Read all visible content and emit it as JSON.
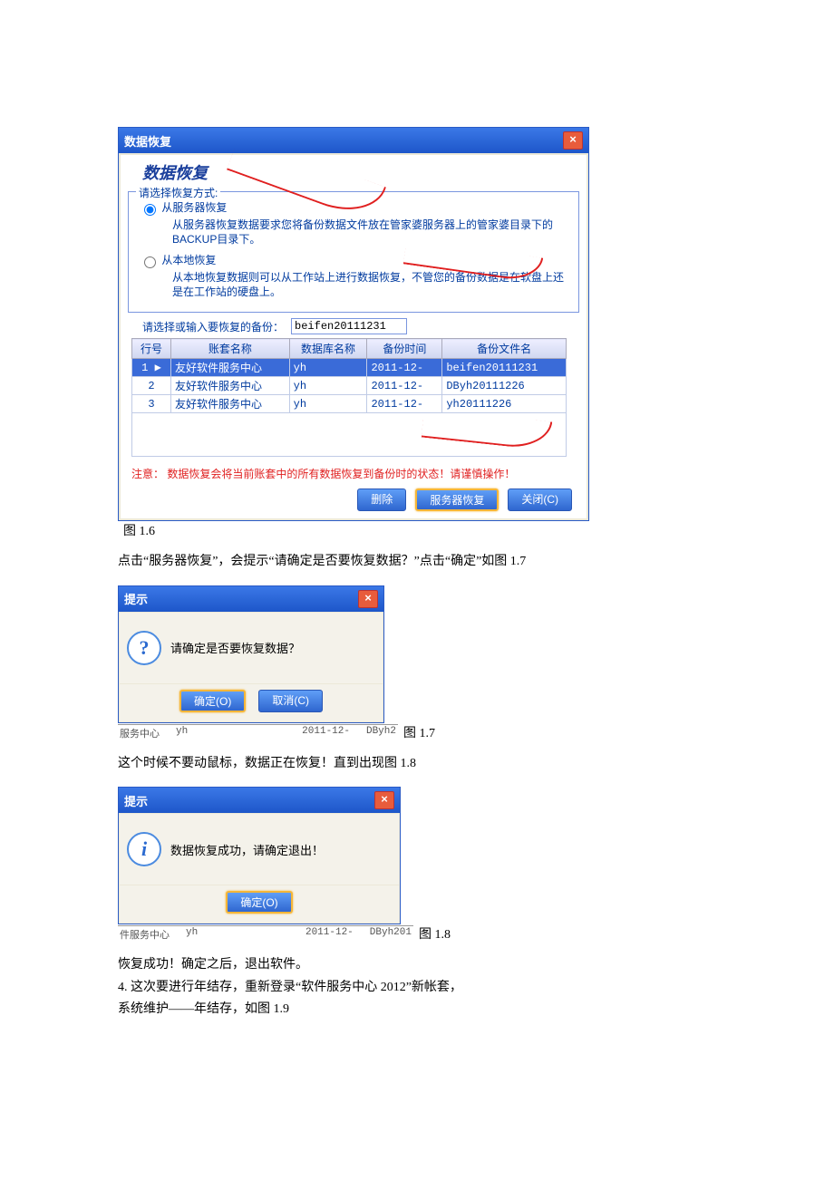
{
  "fig16": {
    "title_bar": "数据恢复",
    "heading": "数据恢复",
    "group_legend": "请选择恢复方式:",
    "radio_server": "从服务器恢复",
    "radio_server_desc": "从服务器恢复数据要求您将备份数据文件放在管家婆服务器上的管家婆目录下的BACKUP目录下。",
    "radio_local": "从本地恢复",
    "radio_local_desc": "从本地恢复数据则可以从工作站上进行数据恢复，不管您的备份数据是在软盘上还是在工作站的硬盘上。",
    "select_label": "请选择或输入要恢复的备份：",
    "select_value": "beifen20111231",
    "columns": {
      "c1": "行号",
      "c2": "账套名称",
      "c3": "数据库名称",
      "c4": "备份时间",
      "c5": "备份文件名"
    },
    "rows": [
      {
        "n": "1",
        "acct": "友好软件服务中心",
        "db": "yh",
        "time": "2011-12-",
        "file": "beifen20111231"
      },
      {
        "n": "2",
        "acct": "友好软件服务中心",
        "db": "yh",
        "time": "2011-12-",
        "file": "DByh20111226"
      },
      {
        "n": "3",
        "acct": "友好软件服务中心",
        "db": "yh",
        "time": "2011-12-",
        "file": "yh20111226"
      }
    ],
    "warning": "注意： 数据恢复会将当前账套中的所有数据恢复到备份时的状态！请谨慎操作！",
    "btn_delete": "删除",
    "btn_restore": "服务器恢复",
    "btn_close": "关闭(C)",
    "caption": "图 1.6"
  },
  "para1": "点击“服务器恢复”，会提示“请确定是否要恢复数据？”点击“确定”如图 1.7",
  "prompt1": {
    "title": "提示",
    "msg": "请确定是否要恢复数据？",
    "ok": "确定(O)",
    "cancel": "取消(C)",
    "ghost1": "服务中心",
    "ghost2": "yh",
    "ghost3": "2011-12-",
    "ghost4": "DByh2",
    "caption": "图 1.7"
  },
  "para2": "这个时候不要动鼠标，数据正在恢复！直到出现图 1.8",
  "prompt2": {
    "title": "提示",
    "msg": "数据恢复成功，请确定退出！",
    "ok": "确定(O)",
    "ghost1": "件服务中心",
    "ghost2": "yh",
    "ghost3": "2011-12-",
    "ghost4": "DByh201",
    "caption": "图 1.8"
  },
  "para3a": "恢复成功！确定之后，退出软件。",
  "para3b": "4.  这次要进行年结存，重新登录“软件服务中心 2012”新帐套，",
  "para3c": "系统维护——年结存，如图 1.9"
}
